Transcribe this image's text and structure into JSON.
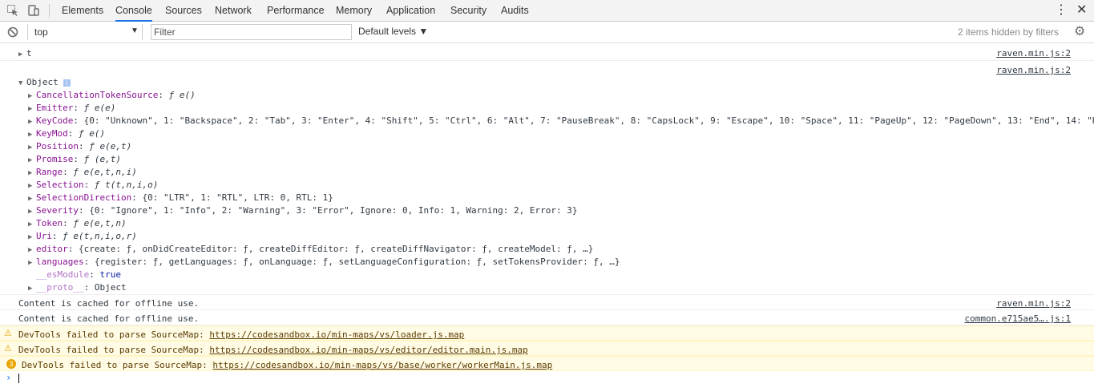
{
  "tabs": [
    "Elements",
    "Console",
    "Sources",
    "Network",
    "Performance",
    "Memory",
    "Application",
    "Security",
    "Audits"
  ],
  "active_tab": "Console",
  "toolbar": {
    "context": "top",
    "filter_placeholder": "Filter",
    "levels": "Default levels ▼",
    "hidden_note": "2 items hidden by filters"
  },
  "console": {
    "t_line": "t",
    "src_raven": "raven.min.js:2",
    "src_common": "common.e715ae5….js:1",
    "object_label": "Object",
    "props": {
      "cts_k": "CancellationTokenSource",
      "cts_v": "ƒ e()",
      "emitter_k": "Emitter",
      "emitter_v": "ƒ e(e)",
      "keycode_k": "KeyCode",
      "keycode_v": "{0: \"Unknown\", 1: \"Backspace\", 2: \"Tab\", 3: \"Enter\", 4: \"Shift\", 5: \"Ctrl\", 6: \"Alt\", 7: \"PauseBreak\", 8: \"CapsLock\", 9: \"Escape\", 10: \"Space\", 11: \"PageUp\", 12: \"PageDown\", 13: \"End\", 14: \"H",
      "keymod_k": "KeyMod",
      "keymod_v": "ƒ e()",
      "position_k": "Position",
      "position_v": "ƒ e(e,t)",
      "promise_k": "Promise",
      "promise_v": "ƒ (e,t)",
      "range_k": "Range",
      "range_v": "ƒ e(e,t,n,i)",
      "selection_k": "Selection",
      "selection_v": "ƒ t(t,n,i,o)",
      "seldir_k": "SelectionDirection",
      "seldir_v": "{0: \"LTR\", 1: \"RTL\", LTR: 0, RTL: 1}",
      "severity_k": "Severity",
      "severity_v": "{0: \"Ignore\", 1: \"Info\", 2: \"Warning\", 3: \"Error\", Ignore: 0, Info: 1, Warning: 2, Error: 3}",
      "token_k": "Token",
      "token_v": "ƒ e(e,t,n)",
      "uri_k": "Uri",
      "uri_v": "ƒ e(t,n,i,o,r)",
      "editor_k": "editor",
      "editor_v": "{create: ƒ, onDidCreateEditor: ƒ, createDiffEditor: ƒ, createDiffNavigator: ƒ, createModel: ƒ, …}",
      "languages_k": "languages",
      "languages_v": "{register: ƒ, getLanguages: ƒ, onLanguage: ƒ, setLanguageConfiguration: ƒ, setTokensProvider: ƒ, …}",
      "esmodule_k": "__esModule",
      "esmodule_v": "true",
      "proto_k": "__proto__",
      "proto_v": "Object"
    },
    "cached_1": "Content is cached for offline use.",
    "cached_2": "Content is cached for offline use.",
    "warn_prefix": "DevTools failed to parse SourceMap:",
    "warn_1_url": "https://codesandbox.io/min-maps/vs/loader.js.map",
    "warn_2_url": "https://codesandbox.io/min-maps/vs/editor/editor.main.js.map",
    "warn_3_url": "https://codesandbox.io/min-maps/vs/base/worker/workerMain.js.map",
    "warn_3_count": "3",
    "prompt": "›"
  },
  "colors": {
    "accent": "#1a73e8",
    "warning_bg": "#fffbe5",
    "warning_icon": "#e7a300"
  }
}
